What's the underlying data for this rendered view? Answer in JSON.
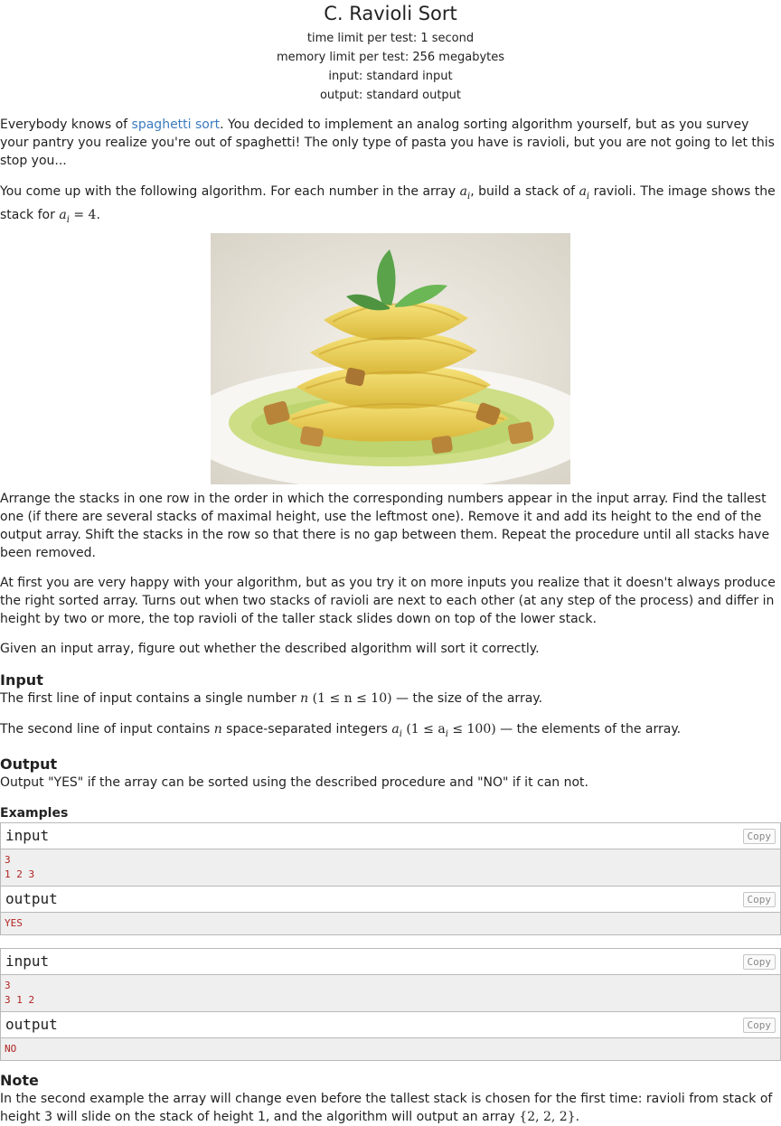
{
  "problem": {
    "title": "C. Ravioli Sort",
    "limits": [
      "time limit per test: 1 second",
      "memory limit per test: 256 megabytes",
      "input: standard input",
      "output: standard output"
    ]
  },
  "statement": {
    "p1_before": "Everybody knows of ",
    "p1_link": "spaghetti sort",
    "p1_after": ". You decided to implement an analog sorting algorithm yourself, but as you survey your pantry you realize you're out of spaghetti! The only type of pasta you have is ravioli, but you are not going to let this stop you...",
    "p2_a": "You come up with the following algorithm. For each number in the array ",
    "p2_b": ", build a stack of ",
    "p2_c": " ravioli. The image shows the stack for ",
    "p2_eq": " = 4",
    "p2_end": ".",
    "math_a": "a",
    "math_i": "i",
    "p3": "Arrange the stacks in one row in the order in which the corresponding numbers appear in the input array. Find the tallest one (if there are several stacks of maximal height, use the leftmost one). Remove it and add its height to the end of the output array. Shift the stacks in the row so that there is no gap between them. Repeat the procedure until all stacks have been removed.",
    "p4": "At first you are very happy with your algorithm, but as you try it on more inputs you realize that it doesn't always produce the right sorted array. Turns out when two stacks of ravioli are next to each other (at any step of the process) and differ in height by two or more, the top ravioli of the taller stack slides down on top of the lower stack.",
    "p5": "Given an input array, figure out whether the described algorithm will sort it correctly."
  },
  "input_spec": {
    "heading": "Input",
    "line1_a": "The first line of input contains a single number ",
    "line1_n": "n",
    "line1_math": " (1 ≤ n ≤ 10)",
    "line1_b": " — the size of the array.",
    "line2_a": "The second line of input contains ",
    "line2_n": "n",
    "line2_b": " space-separated integers ",
    "line2_math": " (1 ≤ a",
    "line2_math2": " ≤ 100)",
    "line2_c": " — the elements of the array."
  },
  "output_spec": {
    "heading": "Output",
    "text": "Output \"YES\" if the array can be sorted using the described procedure and \"NO\" if it can not."
  },
  "examples": {
    "heading": "Examples",
    "copy_label": "Copy",
    "input_label": "input",
    "output_label": "output",
    "tests": [
      {
        "input": [
          "3",
          "1 2 3"
        ],
        "output": [
          "YES"
        ]
      },
      {
        "input": [
          "3",
          "3 1 2"
        ],
        "output": [
          "NO"
        ]
      }
    ]
  },
  "note": {
    "heading": "Note",
    "text": "In the second example the array will change even before the tallest stack is chosen for the first time: ravioli from stack of height 3 will slide on the stack of height 1, and the algorithm will output an array ",
    "math": "{2, 2, 2}",
    "end": "."
  }
}
